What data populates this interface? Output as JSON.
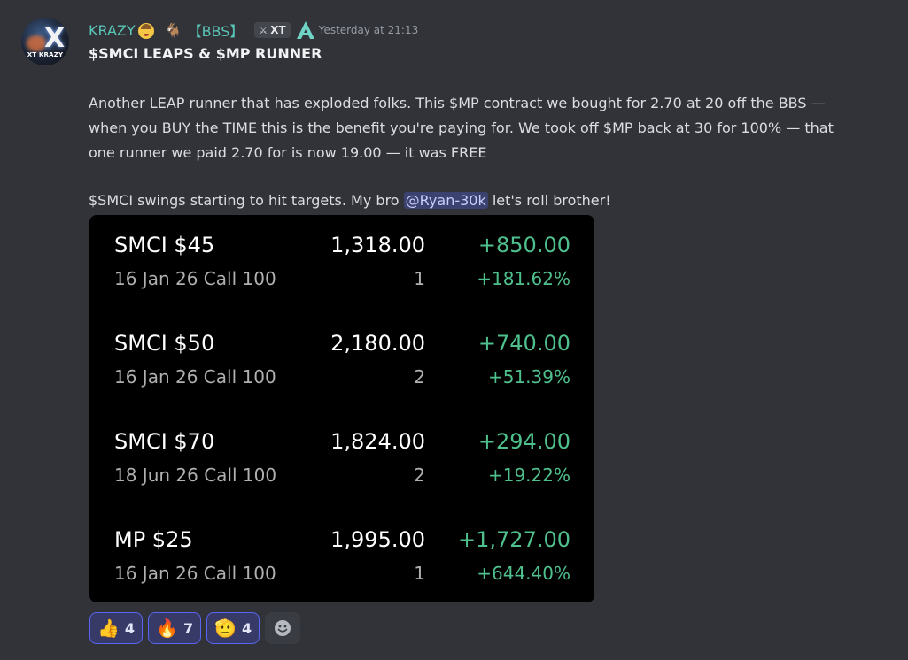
{
  "author": {
    "avatar_text": "XT KRAZY",
    "avatar_letter": "X",
    "username": "KRAZY",
    "tag_emoji": "goat",
    "role_label": "【BBS】",
    "badge_label": "XT",
    "timestamp": "Yesterday at 21:13"
  },
  "message": {
    "title": "$SMCI LEAPS & $MP RUNNER",
    "paragraph1_lines": [
      "Another LEAP runner that has exploded folks. This $MP contract we bought for 2.70 at 20 off the BBS —",
      "when you BUY the TIME this is the benefit you're paying for. We took off $MP back at 30 for 100% — that",
      "one runner we paid 2.70 for is now 19.00 — it was FREE"
    ],
    "paragraph2_before": "$SMCI swings starting to hit targets. My bro ",
    "mention": "@Ryan-30k",
    "paragraph2_after": " let's roll brother!"
  },
  "positions": [
    {
      "ticker": "SMCI $45",
      "details": "16 Jan 26 Call 100",
      "value": "1,318.00",
      "qty": "1",
      "pl": "+850.00",
      "pct": "+181.62%"
    },
    {
      "ticker": "SMCI $50",
      "details": "16 Jan 26 Call 100",
      "value": "2,180.00",
      "qty": "2",
      "pl": "+740.00",
      "pct": "+51.39%"
    },
    {
      "ticker": "SMCI $70",
      "details": "18 Jun 26 Call 100",
      "value": "1,824.00",
      "qty": "2",
      "pl": "+294.00",
      "pct": "+19.22%"
    },
    {
      "ticker": "MP $25",
      "details": "16 Jan 26 Call 100",
      "value": "1,995.00",
      "qty": "1",
      "pl": "+1,727.00",
      "pct": "+644.40%"
    }
  ],
  "reactions": [
    {
      "emoji": "👍",
      "count": "4",
      "name": "thumbs-up"
    },
    {
      "emoji": "🔥",
      "count": "7",
      "name": "fire"
    },
    {
      "emoji": "🫡",
      "count": "4",
      "name": "salute"
    }
  ],
  "colors": {
    "background": "#323339",
    "username": "#5bc6b8",
    "gain": "#4fc08d",
    "mention_bg": "#3c4270",
    "reaction_active_border": "#5865f2"
  }
}
